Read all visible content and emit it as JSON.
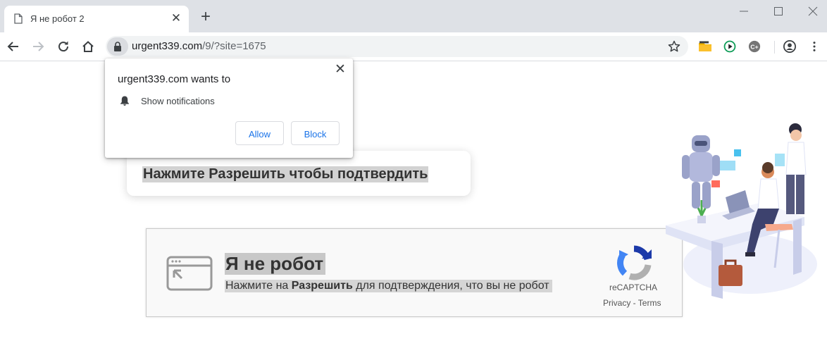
{
  "browser": {
    "tab": {
      "title": "Я не робот 2"
    },
    "address": {
      "domain": "urgent339.com",
      "path": "/9/?site=1675"
    }
  },
  "popup": {
    "title": "urgent339.com wants to",
    "permission": "Show notifications",
    "allow_label": "Allow",
    "block_label": "Block"
  },
  "page": {
    "hint": "Нажмите Разрешить чтобы подтвердить",
    "captcha": {
      "title": "Я не робот",
      "subtitle_pre": "Нажмите на ",
      "subtitle_bold": "Разрешить",
      "subtitle_post": " для подтверждения, что вы не робот",
      "brand": "reCAPTCHA",
      "links": "Privacy - Terms"
    }
  },
  "colors": {
    "accent": "#1a73e8",
    "tabstrip": "#dee1e6",
    "omnibox": "#f1f3f4"
  }
}
